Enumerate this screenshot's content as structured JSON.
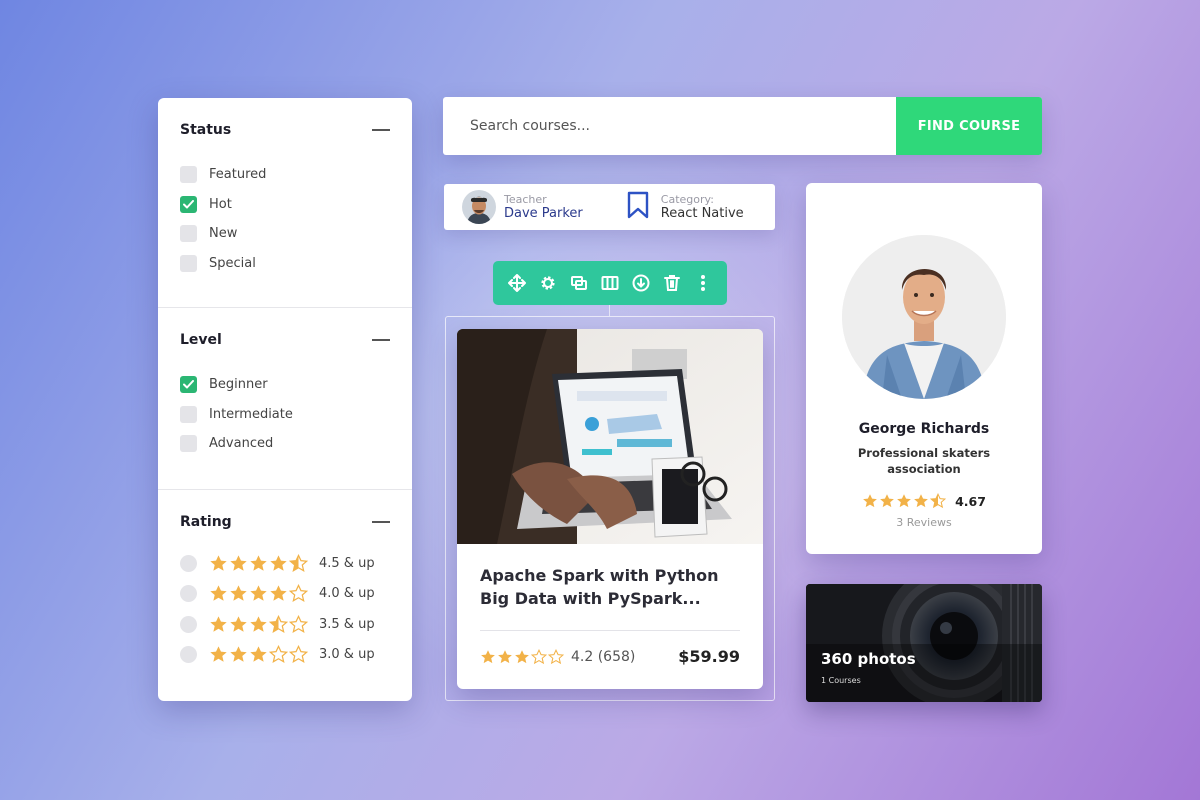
{
  "filter": {
    "status": {
      "title": "Status",
      "options": [
        {
          "label": "Featured",
          "checked": false
        },
        {
          "label": "Hot",
          "checked": true
        },
        {
          "label": "New",
          "checked": false
        },
        {
          "label": "Special",
          "checked": false
        }
      ]
    },
    "level": {
      "title": "Level",
      "options": [
        {
          "label": "Beginner",
          "checked": true
        },
        {
          "label": "Intermediate",
          "checked": false
        },
        {
          "label": "Advanced",
          "checked": false
        }
      ]
    },
    "rating": {
      "title": "Rating",
      "options": [
        {
          "label": "4.5 & up",
          "stars": 4.5
        },
        {
          "label": "4.0 & up",
          "stars": 4.0
        },
        {
          "label": "3.5 & up",
          "stars": 3.5
        },
        {
          "label": "3.0 & up",
          "stars": 3.0
        }
      ]
    }
  },
  "search": {
    "placeholder": "Search courses...",
    "button_label": "FIND COURSE"
  },
  "teacher": {
    "label": "Teacher",
    "name": "Dave Parker",
    "category_label": "Category:",
    "category": "React Native"
  },
  "toolbar": {
    "icons": [
      "move-icon",
      "settings-icon",
      "duplicate-icon",
      "columns-icon",
      "download-icon",
      "delete-icon",
      "more-vertical-icon"
    ]
  },
  "course": {
    "title_line1": "Apache Spark with Python",
    "title_line2": "Big Data with PySpark...",
    "stars": 3,
    "rating": "4.2 (658)",
    "price": "$59.99"
  },
  "profile": {
    "name": "George Richards",
    "org": "Professional skaters association",
    "stars": 4.5,
    "rating": "4.67",
    "reviews": "3 Reviews"
  },
  "photo": {
    "title": "360 photos",
    "subtitle": "1 Courses"
  },
  "colors": {
    "accent_green": "#2fd87a",
    "toolbar_teal": "#2fc79c",
    "checkbox_green": "#2bb673",
    "star_gold": "#f2b248",
    "teacher_blue": "#2b3a8c"
  }
}
